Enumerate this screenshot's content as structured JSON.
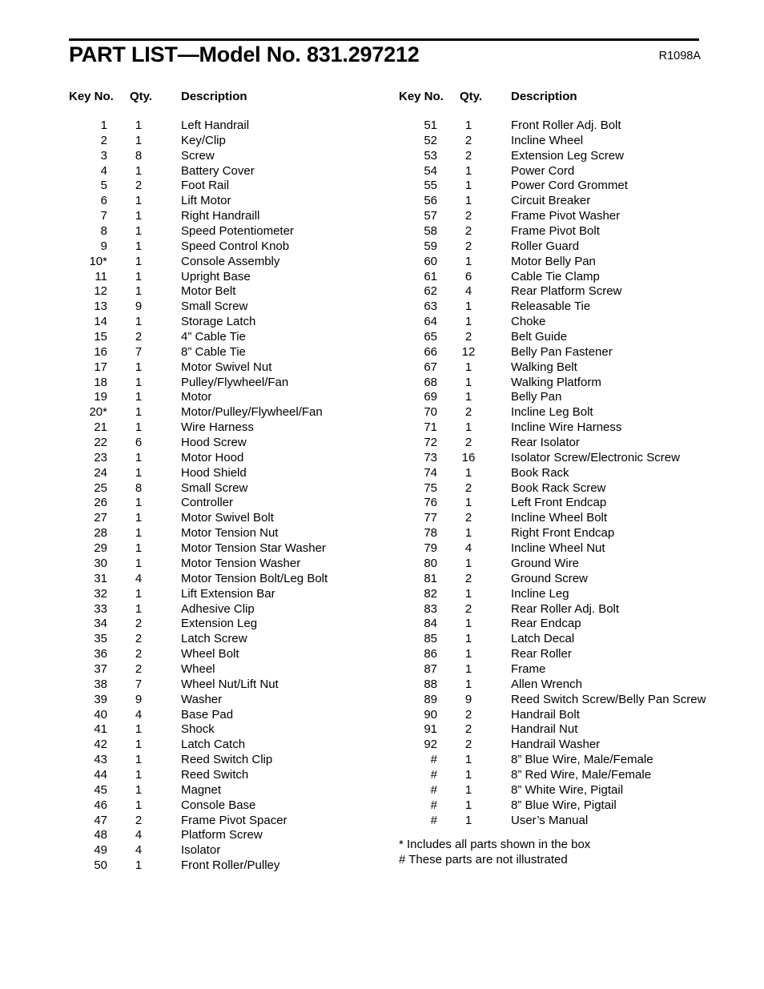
{
  "header": {
    "title": "PART LIST—Model No. 831.297212",
    "revision_code": "R1098A"
  },
  "table": {
    "headers": {
      "key_no": "Key No.",
      "qty": "Qty.",
      "description": "Description"
    },
    "left_column": [
      {
        "key": "1",
        "qty": "1",
        "desc": "Left Handrail"
      },
      {
        "key": "2",
        "qty": "1",
        "desc": "Key/Clip"
      },
      {
        "key": "3",
        "qty": "8",
        "desc": "Screw"
      },
      {
        "key": "4",
        "qty": "1",
        "desc": "Battery Cover"
      },
      {
        "key": "5",
        "qty": "2",
        "desc": "Foot Rail"
      },
      {
        "key": "6",
        "qty": "1",
        "desc": "Lift Motor"
      },
      {
        "key": "7",
        "qty": "1",
        "desc": "Right Handraill"
      },
      {
        "key": "8",
        "qty": "1",
        "desc": "Speed Potentiometer"
      },
      {
        "key": "9",
        "qty": "1",
        "desc": "Speed Control Knob"
      },
      {
        "key": "10*",
        "qty": "1",
        "desc": "Console Assembly"
      },
      {
        "key": "11",
        "qty": "1",
        "desc": "Upright Base"
      },
      {
        "key": "12",
        "qty": "1",
        "desc": "Motor Belt"
      },
      {
        "key": "13",
        "qty": "9",
        "desc": "Small Screw"
      },
      {
        "key": "14",
        "qty": "1",
        "desc": "Storage Latch"
      },
      {
        "key": "15",
        "qty": "2",
        "desc": "4” Cable Tie"
      },
      {
        "key": "16",
        "qty": "7",
        "desc": "8” Cable Tie"
      },
      {
        "key": "17",
        "qty": "1",
        "desc": "Motor Swivel Nut"
      },
      {
        "key": "18",
        "qty": "1",
        "desc": "Pulley/Flywheel/Fan"
      },
      {
        "key": "19",
        "qty": "1",
        "desc": "Motor"
      },
      {
        "key": "20*",
        "qty": "1",
        "desc": "Motor/Pulley/Flywheel/Fan"
      },
      {
        "key": "21",
        "qty": "1",
        "desc": "Wire Harness"
      },
      {
        "key": "22",
        "qty": "6",
        "desc": "Hood Screw"
      },
      {
        "key": "23",
        "qty": "1",
        "desc": "Motor Hood"
      },
      {
        "key": "24",
        "qty": "1",
        "desc": "Hood Shield"
      },
      {
        "key": "25",
        "qty": "8",
        "desc": "Small Screw"
      },
      {
        "key": "26",
        "qty": "1",
        "desc": "Controller"
      },
      {
        "key": "27",
        "qty": "1",
        "desc": "Motor Swivel Bolt"
      },
      {
        "key": "28",
        "qty": "1",
        "desc": "Motor Tension Nut"
      },
      {
        "key": "29",
        "qty": "1",
        "desc": "Motor Tension Star Washer"
      },
      {
        "key": "30",
        "qty": "1",
        "desc": "Motor Tension Washer"
      },
      {
        "key": "31",
        "qty": "4",
        "desc": "Motor Tension Bolt/Leg Bolt"
      },
      {
        "key": "32",
        "qty": "1",
        "desc": "Lift Extension Bar"
      },
      {
        "key": "33",
        "qty": "1",
        "desc": "Adhesive Clip"
      },
      {
        "key": "34",
        "qty": "2",
        "desc": "Extension Leg"
      },
      {
        "key": "35",
        "qty": "2",
        "desc": "Latch Screw"
      },
      {
        "key": "36",
        "qty": "2",
        "desc": "Wheel Bolt"
      },
      {
        "key": "37",
        "qty": "2",
        "desc": "Wheel"
      },
      {
        "key": "38",
        "qty": "7",
        "desc": "Wheel Nut/Lift Nut"
      },
      {
        "key": "39",
        "qty": "9",
        "desc": "Washer"
      },
      {
        "key": "40",
        "qty": "4",
        "desc": "Base Pad"
      },
      {
        "key": "41",
        "qty": "1",
        "desc": "Shock"
      },
      {
        "key": "42",
        "qty": "1",
        "desc": "Latch Catch"
      },
      {
        "key": "43",
        "qty": "1",
        "desc": "Reed Switch Clip"
      },
      {
        "key": "44",
        "qty": "1",
        "desc": "Reed Switch"
      },
      {
        "key": "45",
        "qty": "1",
        "desc": "Magnet"
      },
      {
        "key": "46",
        "qty": "1",
        "desc": "Console Base"
      },
      {
        "key": "47",
        "qty": "2",
        "desc": "Frame Pivot Spacer"
      },
      {
        "key": "48",
        "qty": "4",
        "desc": "Platform Screw"
      },
      {
        "key": "49",
        "qty": "4",
        "desc": "Isolator"
      },
      {
        "key": "50",
        "qty": "1",
        "desc": "Front Roller/Pulley"
      }
    ],
    "right_column": [
      {
        "key": "51",
        "qty": "1",
        "desc": "Front Roller Adj. Bolt"
      },
      {
        "key": "52",
        "qty": "2",
        "desc": "Incline Wheel"
      },
      {
        "key": "53",
        "qty": "2",
        "desc": "Extension Leg Screw"
      },
      {
        "key": "54",
        "qty": "1",
        "desc": "Power Cord"
      },
      {
        "key": "55",
        "qty": "1",
        "desc": "Power Cord Grommet"
      },
      {
        "key": "56",
        "qty": "1",
        "desc": "Circuit Breaker"
      },
      {
        "key": "57",
        "qty": "2",
        "desc": "Frame Pivot Washer"
      },
      {
        "key": "58",
        "qty": "2",
        "desc": "Frame Pivot Bolt"
      },
      {
        "key": "59",
        "qty": "2",
        "desc": "Roller Guard"
      },
      {
        "key": "60",
        "qty": "1",
        "desc": "Motor Belly Pan"
      },
      {
        "key": "61",
        "qty": "6",
        "desc": "Cable Tie Clamp"
      },
      {
        "key": "62",
        "qty": "4",
        "desc": "Rear Platform Screw"
      },
      {
        "key": "63",
        "qty": "1",
        "desc": "Releasable Tie"
      },
      {
        "key": "64",
        "qty": "1",
        "desc": "Choke"
      },
      {
        "key": "65",
        "qty": "2",
        "desc": "Belt Guide"
      },
      {
        "key": "66",
        "qty": "12",
        "desc": "Belly Pan Fastener"
      },
      {
        "key": "67",
        "qty": "1",
        "desc": "Walking Belt"
      },
      {
        "key": "68",
        "qty": "1",
        "desc": "Walking Platform"
      },
      {
        "key": "69",
        "qty": "1",
        "desc": "Belly Pan"
      },
      {
        "key": "70",
        "qty": "2",
        "desc": "Incline Leg Bolt"
      },
      {
        "key": "71",
        "qty": "1",
        "desc": "Incline Wire Harness"
      },
      {
        "key": "72",
        "qty": "2",
        "desc": "Rear Isolator"
      },
      {
        "key": "73",
        "qty": "16",
        "desc": "Isolator Screw/Electronic Screw"
      },
      {
        "key": "74",
        "qty": "1",
        "desc": "Book Rack"
      },
      {
        "key": "75",
        "qty": "2",
        "desc": "Book Rack Screw"
      },
      {
        "key": "76",
        "qty": "1",
        "desc": "Left Front Endcap"
      },
      {
        "key": "77",
        "qty": "2",
        "desc": "Incline Wheel Bolt"
      },
      {
        "key": "78",
        "qty": "1",
        "desc": "Right Front Endcap"
      },
      {
        "key": "79",
        "qty": "4",
        "desc": "Incline Wheel Nut"
      },
      {
        "key": "80",
        "qty": "1",
        "desc": "Ground Wire"
      },
      {
        "key": "81",
        "qty": "2",
        "desc": "Ground Screw"
      },
      {
        "key": "82",
        "qty": "1",
        "desc": "Incline Leg"
      },
      {
        "key": "83",
        "qty": "2",
        "desc": "Rear Roller Adj. Bolt"
      },
      {
        "key": "84",
        "qty": "1",
        "desc": "Rear Endcap"
      },
      {
        "key": "85",
        "qty": "1",
        "desc": "Latch Decal"
      },
      {
        "key": "86",
        "qty": "1",
        "desc": "Rear Roller"
      },
      {
        "key": "87",
        "qty": "1",
        "desc": "Frame"
      },
      {
        "key": "88",
        "qty": "1",
        "desc": "Allen Wrench"
      },
      {
        "key": "89",
        "qty": "9",
        "desc": "Reed Switch Screw/Belly Pan Screw"
      },
      {
        "key": "90",
        "qty": "2",
        "desc": "Handrail Bolt"
      },
      {
        "key": "91",
        "qty": "2",
        "desc": "Handrail Nut"
      },
      {
        "key": "92",
        "qty": "2",
        "desc": "Handrail Washer"
      },
      {
        "key": "#",
        "qty": "1",
        "desc": "8” Blue Wire, Male/Female"
      },
      {
        "key": "#",
        "qty": "1",
        "desc": "8” Red Wire, Male/Female"
      },
      {
        "key": "#",
        "qty": "1",
        "desc": "8” White Wire, Pigtail"
      },
      {
        "key": "#",
        "qty": "1",
        "desc": "8” Blue Wire, Pigtail"
      },
      {
        "key": "#",
        "qty": "1",
        "desc": "User’s Manual"
      }
    ]
  },
  "footnotes": [
    "* Includes all parts shown in the box",
    "# These parts are not illustrated"
  ]
}
